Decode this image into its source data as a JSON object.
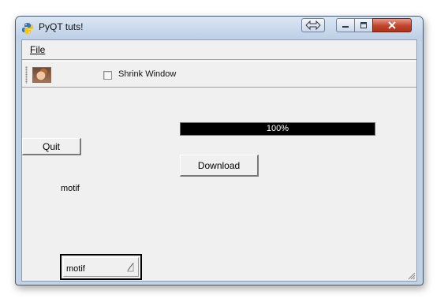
{
  "window": {
    "title": "PyQT tuts!",
    "icon": "python-icon"
  },
  "menubar": {
    "items": [
      {
        "label": "File"
      }
    ]
  },
  "toolbar": {
    "avatar_icon": "face-photo-icon",
    "checkbox": {
      "label": "Shrink Window",
      "checked": false
    }
  },
  "content": {
    "progress": {
      "value_percent": 100,
      "text": "100%"
    },
    "quit_label": "Quit",
    "download_label": "Download",
    "style_label": "motif",
    "style_combo": {
      "selected": "motif"
    }
  }
}
